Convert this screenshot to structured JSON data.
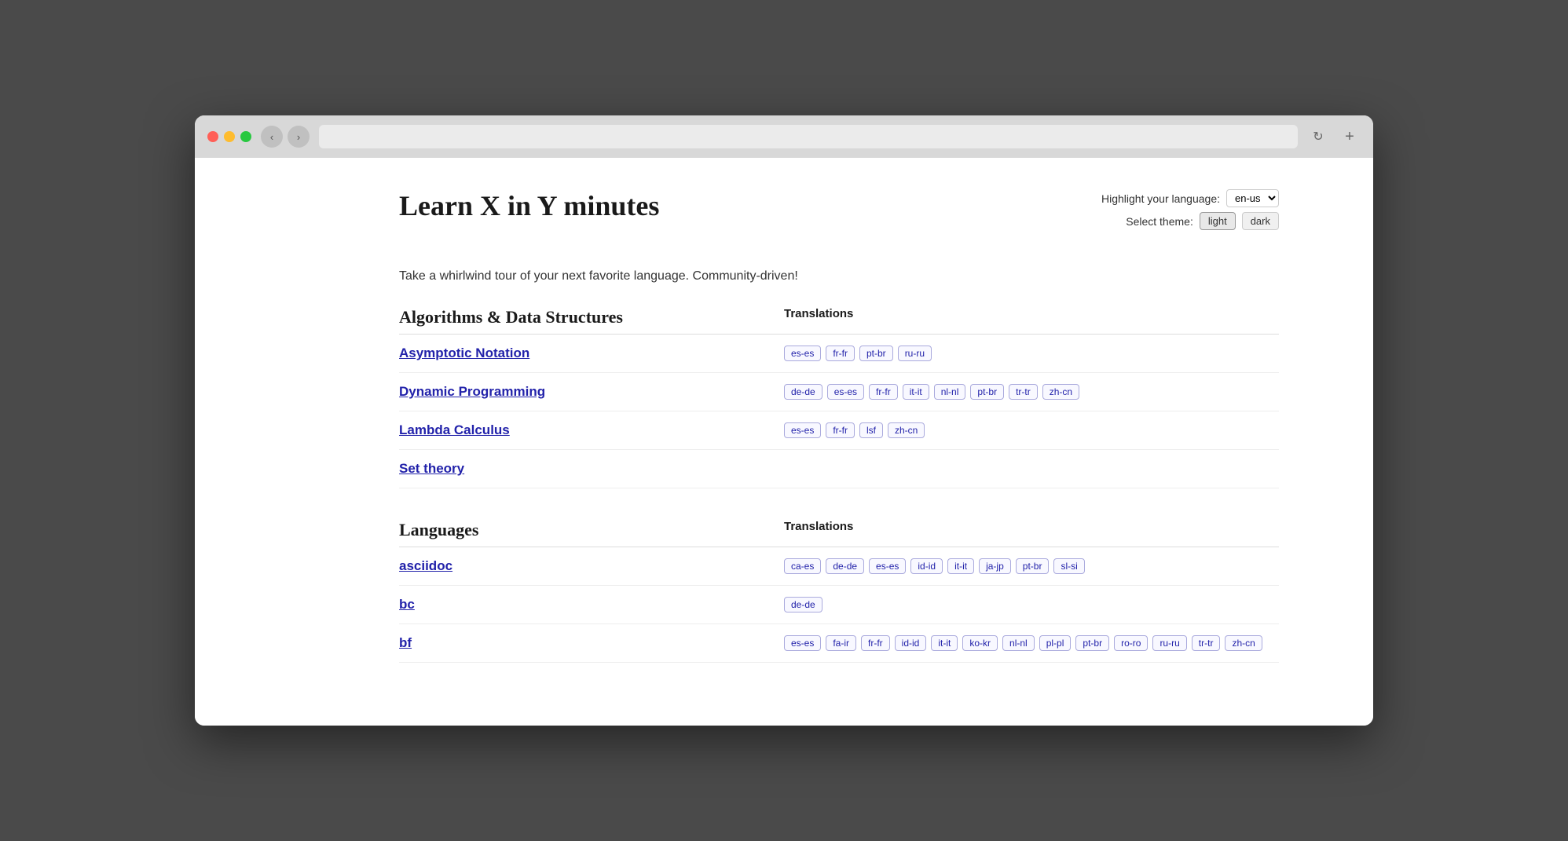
{
  "browser": {
    "back_label": "‹",
    "forward_label": "›",
    "refresh_label": "↻",
    "new_tab_label": "+"
  },
  "controls": {
    "highlight_label": "Highlight your language:",
    "lang_value": "en-us",
    "theme_label": "Select theme:",
    "theme_light": "light",
    "theme_dark": "dark"
  },
  "page": {
    "title": "Learn X in Y minutes",
    "tagline": "Take a whirlwind tour of your next favorite language. Community-driven!"
  },
  "algorithms_section": {
    "title": "Algorithms & Data Structures",
    "translations_col": "Translations",
    "items": [
      {
        "label": "Asymptotic Notation",
        "tags": [
          "es-es",
          "fr-fr",
          "pt-br",
          "ru-ru"
        ]
      },
      {
        "label": "Dynamic Programming",
        "tags": [
          "de-de",
          "es-es",
          "fr-fr",
          "it-it",
          "nl-nl",
          "pt-br",
          "tr-tr",
          "zh-cn"
        ]
      },
      {
        "label": "Lambda Calculus",
        "tags": [
          "es-es",
          "fr-fr",
          "lsf",
          "zh-cn"
        ]
      },
      {
        "label": "Set theory",
        "tags": []
      }
    ]
  },
  "languages_section": {
    "title": "Languages",
    "translations_col": "Translations",
    "items": [
      {
        "label": "asciidoc",
        "tags": [
          "ca-es",
          "de-de",
          "es-es",
          "id-id",
          "it-it",
          "ja-jp",
          "pt-br",
          "sl-si"
        ]
      },
      {
        "label": "bc",
        "tags": [
          "de-de"
        ]
      },
      {
        "label": "bf",
        "tags": [
          "es-es",
          "fa-ir",
          "fr-fr",
          "id-id",
          "it-it",
          "ko-kr",
          "nl-nl",
          "pl-pl",
          "pt-br",
          "ro-ro",
          "ru-ru",
          "tr-tr",
          "zh-cn"
        ]
      }
    ]
  }
}
